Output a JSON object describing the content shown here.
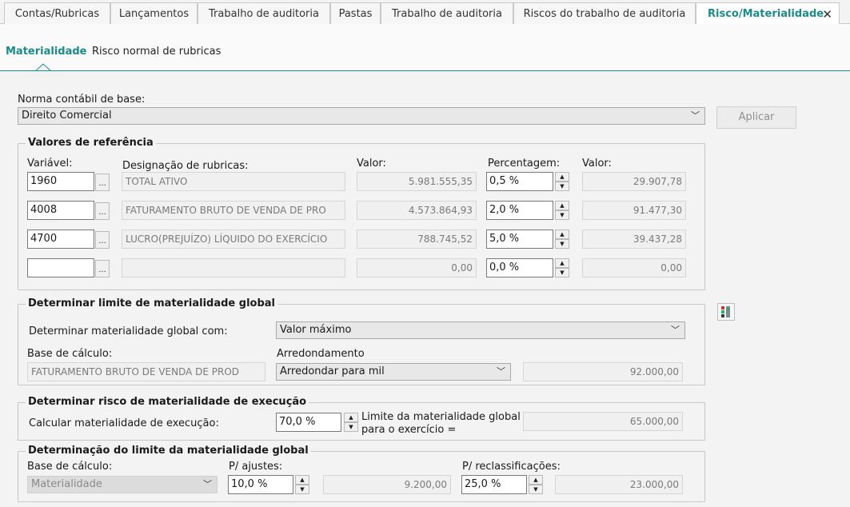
{
  "top_tabs": [
    "Contas/Rubricas",
    "Lançamentos",
    "Trabalho de auditoria",
    "Pastas",
    "Trabalho de auditoria",
    "Riscos do trabalho de auditoria",
    "Risco/Materialidade"
  ],
  "sub_tabs": [
    "Materialidade",
    "Risco normal de rubricas"
  ],
  "norma": {
    "label": "Norma contábil de base:",
    "value": "Direito Comercial",
    "apply_label": "Aplicar"
  },
  "ref": {
    "title": "Valores de referência",
    "col_variavel": "Variável:",
    "col_designacao": "Designação de rubricas:",
    "col_valor": "Valor:",
    "col_percentagem": "Percentagem:",
    "col_valor2": "Valor:",
    "rows": [
      {
        "variavel": "1960",
        "designacao": "TOTAL ATIVO",
        "valor": "5.981.555,35",
        "percentagem": "0,5  %",
        "valor2": "29.907,78"
      },
      {
        "variavel": "4008",
        "designacao": "FATURAMENTO BRUTO DE VENDA DE PRO",
        "valor": "4.573.864,93",
        "percentagem": "2,0  %",
        "valor2": "91.477,30"
      },
      {
        "variavel": "4700",
        "designacao": "LUCRO(PREJUÍZO) LÍQUIDO DO EXERCÍCIO",
        "valor": "788.745,52",
        "percentagem": "5,0  %",
        "valor2": "39.437,28"
      },
      {
        "variavel": "",
        "designacao": "",
        "valor": "0,00",
        "percentagem": "0,0  %",
        "valor2": "0,00"
      }
    ]
  },
  "global": {
    "title": "Determinar limite de materialidade global",
    "det_label": "Determinar materialidade global com:",
    "det_value": "Valor máximo",
    "base_label": "Base de cálculo:",
    "base_value": "FATURAMENTO BRUTO DE VENDA DE PROD",
    "arred_label": "Arredondamento",
    "arred_value": "Arredondar para mil",
    "result": "92.000,00"
  },
  "exec": {
    "title": "Determinar risco de materialidade de execução",
    "calc_label": "Calcular materialidade de execução:",
    "percent": "70,0  %",
    "limit_label_1": "Limite da materialidade global",
    "limit_label_2": "para o exercício =",
    "result": "65.000,00"
  },
  "limite": {
    "title": "Determinação do limite da materialidade global",
    "base_label": "Base de cálculo:",
    "base_value": "Materialidade",
    "ajustes_label": "P/ ajustes:",
    "ajustes_percent": "10,0  %",
    "ajustes_value": "9.200,00",
    "reclass_label": "P/ reclassificações:",
    "reclass_percent": "25,0  %",
    "reclass_value": "23.000,00"
  },
  "colors": {
    "accent": "#1d8a8a"
  },
  "icons": {
    "close": "close-icon",
    "dropdown": "chevron-down-icon",
    "spin_up": "arrow-up-icon",
    "spin_down": "arrow-down-icon",
    "calc": "calculator-icon"
  }
}
